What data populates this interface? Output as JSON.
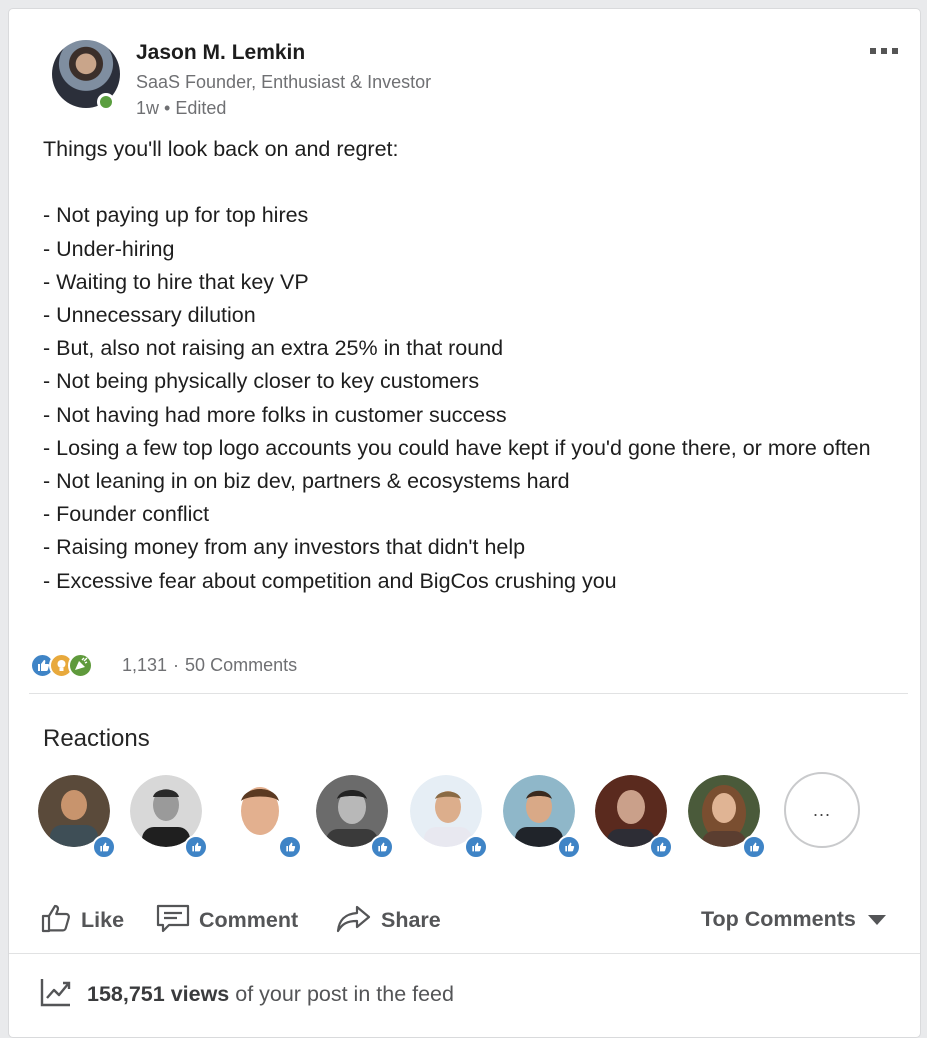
{
  "author": {
    "name": "Jason M. Lemkin",
    "headline": "SaaS Founder, Enthusiast & Investor",
    "meta": "1w • Edited"
  },
  "post": {
    "intro": "Things you'll look back on and regret:",
    "lines": [
      "- Not paying up for top hires",
      "- Under-hiring",
      "- Waiting to hire that key VP",
      "- Unnecessary dilution",
      "- But, also not raising an extra 25% in that round",
      "- Not being physically closer to key customers",
      "- Not having had more folks in customer success",
      "- Losing a few top logo accounts you could have kept if you'd gone there, or more often",
      "- Not leaning in on biz dev, partners & ecosystems hard",
      "- Founder conflict",
      "- Raising money from any investors that didn't help",
      "- Excessive fear about competition and BigCos crushing you"
    ]
  },
  "social": {
    "reaction_count": "1,131",
    "separator": "·",
    "comments": "50 Comments",
    "reaction_icons": [
      "like-icon",
      "insightful-icon",
      "celebrate-icon"
    ]
  },
  "reactions": {
    "title": "Reactions",
    "more_label": "...",
    "people_count": 8
  },
  "actions": {
    "like": "Like",
    "comment": "Comment",
    "share": "Share",
    "sort": "Top Comments"
  },
  "views": {
    "count": "158,751 views",
    "suffix": " of your post in the feed"
  },
  "colors": {
    "like_blue": "#3f84c6",
    "insight_gold": "#e8a93c",
    "celebrate_green": "#5f9a3c",
    "online_green": "#5a9e3f",
    "muted_text": "#6f7073"
  }
}
